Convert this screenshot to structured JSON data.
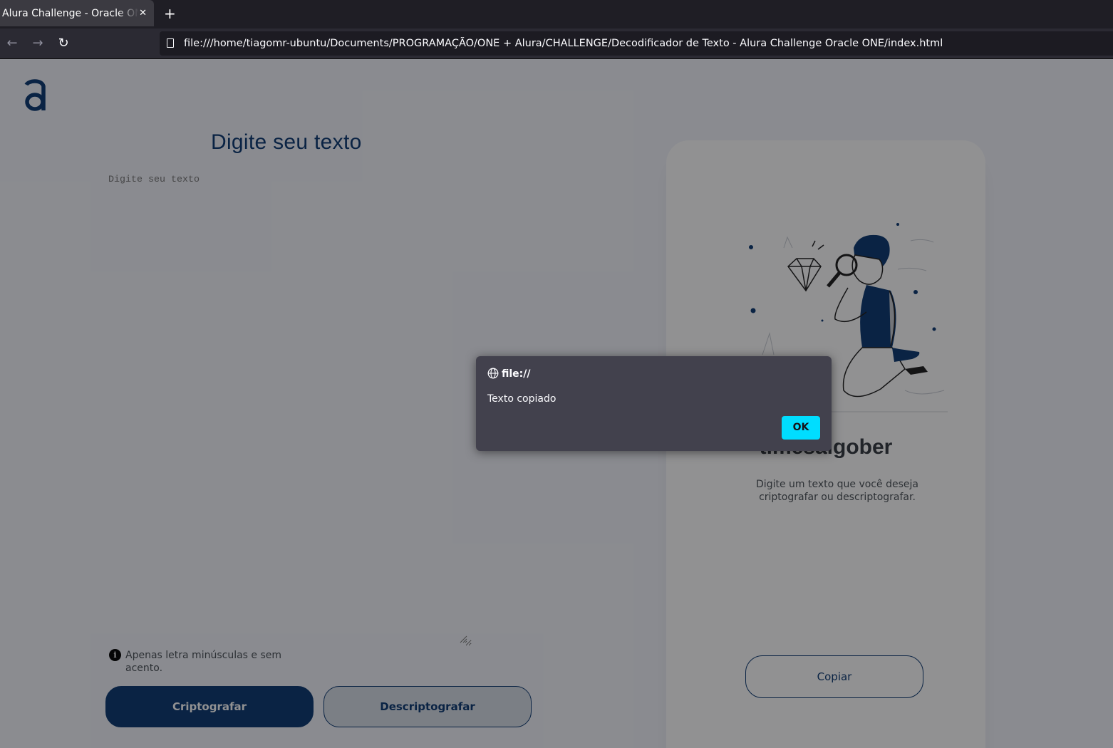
{
  "browser": {
    "tab_title": "Alura Challenge - Oracle ONE",
    "close_tab_glyph": "✕",
    "new_tab_glyph": "+",
    "back_glyph": "←",
    "forward_glyph": "→",
    "reload_glyph": "↻",
    "url": "file:///home/tiagomr-ubuntu/Documents/PROGRAMAÇÃO/ONE + Alura/CHALLENGE/Decodificador de Texto - Alura Challenge Oracle ONE/index.html"
  },
  "page": {
    "logo_icon": "alura-logo-icon",
    "input_placeholder": "Digite seu texto",
    "info_icon_glyph": "i",
    "info_text": "Apenas letra minúsculas e sem acento.",
    "encrypt_label": "Criptografar",
    "decrypt_label": "Descriptografar",
    "output_title": "timesaigober",
    "output_subtitle": "Digite um texto que você deseja criptografar ou descriptografar.",
    "copy_label": "Copiar",
    "illustration_icon": "boy-with-magnifier-illustration"
  },
  "dialog": {
    "origin": "file://",
    "message": "Texto copiado",
    "ok_label": "OK"
  },
  "colors": {
    "accent": "#0a3871",
    "dialog_bg": "#42414d",
    "ok_button": "#00ddff"
  }
}
